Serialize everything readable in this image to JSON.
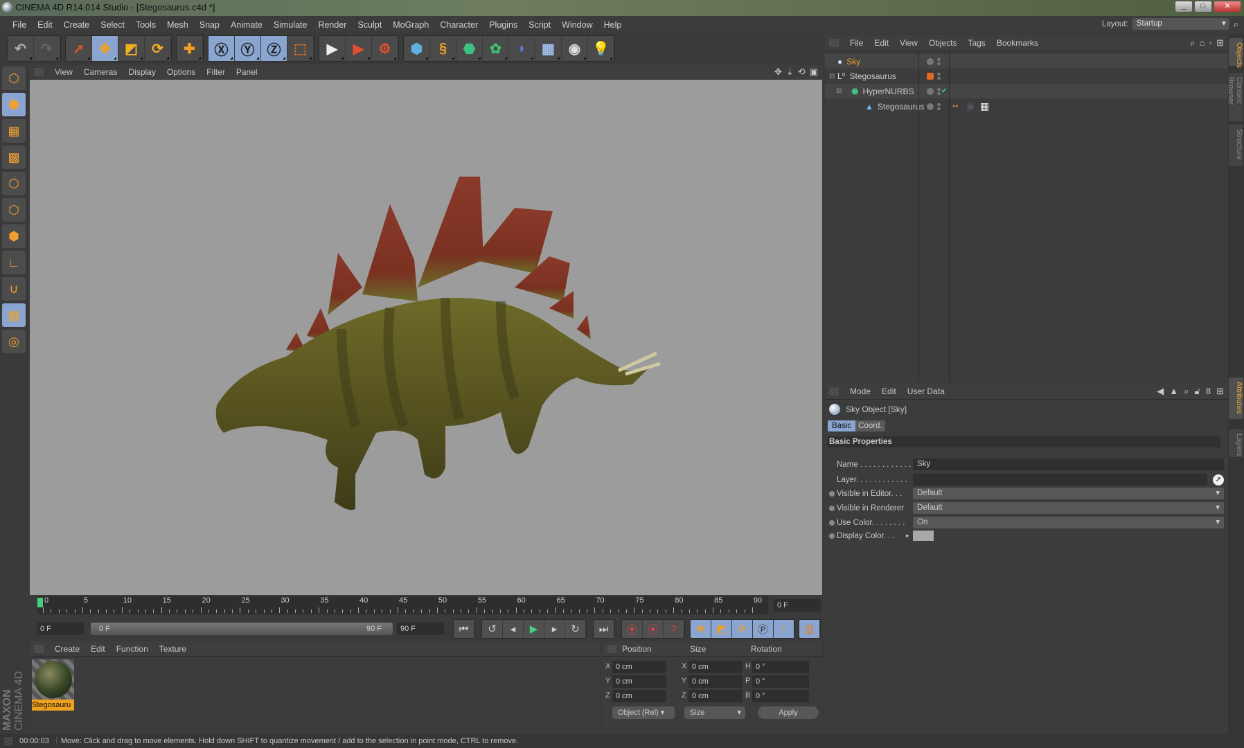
{
  "window": {
    "title": "CINEMA 4D R14.014 Studio - [Stegosaurus.c4d *]",
    "minimize": "_",
    "maximize": "□",
    "close": "✕"
  },
  "menu": [
    "File",
    "Edit",
    "Create",
    "Select",
    "Tools",
    "Mesh",
    "Snap",
    "Animate",
    "Simulate",
    "Render",
    "Sculpt",
    "MoGraph",
    "Character",
    "Plugins",
    "Script",
    "Window",
    "Help"
  ],
  "layout": {
    "label": "Layout:",
    "value": "Startup"
  },
  "toolbar": [
    {
      "group": [
        {
          "icon": "undo-icon",
          "glyph": "↶",
          "color": "#aaa"
        },
        {
          "icon": "redo-icon",
          "glyph": "↷",
          "color": "#666"
        }
      ]
    },
    {
      "group": [
        {
          "icon": "live-selection-icon",
          "glyph": "➚",
          "color": "#e05030"
        },
        {
          "icon": "move-icon",
          "glyph": "✥",
          "color": "#f0a020",
          "active": true
        },
        {
          "icon": "scale-icon",
          "glyph": "◩",
          "color": "#f0b020"
        },
        {
          "icon": "rotate-icon",
          "glyph": "⟳",
          "color": "#f0b020"
        }
      ]
    },
    {
      "group": [
        {
          "icon": "transform-icon",
          "glyph": "✚",
          "color": "#f0a020"
        }
      ]
    },
    {
      "group": [
        {
          "icon": "x-axis-icon",
          "glyph": "Ⓧ",
          "color": "#222",
          "active": true
        },
        {
          "icon": "y-axis-icon",
          "glyph": "Ⓨ",
          "color": "#222",
          "active": true
        },
        {
          "icon": "z-axis-icon",
          "glyph": "Ⓩ",
          "color": "#222",
          "active": true
        },
        {
          "icon": "coordinate-system-icon",
          "glyph": "⬚",
          "color": "#e07020"
        }
      ]
    },
    {
      "group": [
        {
          "icon": "render-view-icon",
          "glyph": "▶",
          "color": "#eee"
        },
        {
          "icon": "render-picture-viewer-icon",
          "glyph": "▶",
          "color": "#e05030"
        },
        {
          "icon": "render-settings-icon",
          "glyph": "⚙",
          "color": "#e05030"
        }
      ]
    },
    {
      "group": [
        {
          "icon": "cube-icon",
          "glyph": "⬢",
          "color": "#60b0e0"
        },
        {
          "icon": "spline-icon",
          "glyph": "§",
          "color": "#f0a020"
        },
        {
          "icon": "nurbs-icon",
          "glyph": "⬣",
          "color": "#40c080"
        },
        {
          "icon": "array-icon",
          "glyph": "✿",
          "color": "#40c070"
        },
        {
          "icon": "deformer-icon",
          "glyph": "◗",
          "color": "#6080e0"
        },
        {
          "icon": "floor-icon",
          "glyph": "▦",
          "color": "#a0c0f0"
        },
        {
          "icon": "camera-icon",
          "glyph": "◉",
          "color": "#ddd"
        },
        {
          "icon": "light-icon",
          "glyph": "💡",
          "color": "#eee"
        }
      ]
    }
  ],
  "left_tools": [
    {
      "icon": "model-icon",
      "glyph": "⬡"
    },
    {
      "icon": "object-mode-icon",
      "glyph": "⬢",
      "active": true
    },
    {
      "icon": "texture-icon",
      "glyph": "▦"
    },
    {
      "icon": "workplane-icon",
      "glyph": "▩"
    },
    {
      "icon": "points-icon",
      "glyph": "⬡"
    },
    {
      "icon": "edges-icon",
      "glyph": "⬡"
    },
    {
      "icon": "polygons-icon",
      "glyph": "⬢"
    },
    {
      "icon": "axis-icon",
      "glyph": "∟"
    },
    {
      "icon": "magnet-icon",
      "glyph": "∪"
    },
    {
      "icon": "grid-lock-icon",
      "glyph": "▦",
      "active": true
    },
    {
      "icon": "snap-icon",
      "glyph": "◎"
    }
  ],
  "viewport": {
    "menu": [
      "View",
      "Cameras",
      "Display",
      "Options",
      "Filter",
      "Panel"
    ]
  },
  "object_manager": {
    "menu": [
      "File",
      "Edit",
      "View",
      "Objects",
      "Tags",
      "Bookmarks"
    ],
    "objects": [
      {
        "name": "Sky",
        "selected": true,
        "indent": 0,
        "icon": "sky-icon"
      },
      {
        "name": "Stegosaurus",
        "indent": 0,
        "icon": "null-object-icon"
      },
      {
        "name": "HyperNURBS",
        "indent": 1,
        "icon": "hypernurbs-icon"
      },
      {
        "name": "Stegosaurus",
        "indent": 2,
        "icon": "polygon-object-icon"
      }
    ]
  },
  "side_tabs": [
    "Objects",
    "Content Browser",
    "Structure",
    "Attributes",
    "Layers"
  ],
  "attributes": {
    "menu": [
      "Mode",
      "Edit",
      "User Data"
    ],
    "object_title": "Sky Object [Sky]",
    "tabs": [
      "Basic",
      "Coord."
    ],
    "section": "Basic Properties",
    "fields": [
      {
        "label": "Name . . . . . . . . . . . .",
        "value": "Sky"
      },
      {
        "label": "Layer. . . . . . . . . . . .",
        "value": ""
      },
      {
        "label": "Visible in Editor. . .",
        "value": "Default"
      },
      {
        "label": "Visible in Renderer",
        "value": "Default"
      },
      {
        "label": "Use Color. . . . . . . .",
        "value": "On"
      },
      {
        "label": "Display Color. . .",
        "value": ""
      }
    ],
    "display_color": "#a8a8a8"
  },
  "timeline": {
    "ticks": [
      0,
      5,
      10,
      15,
      20,
      25,
      30,
      35,
      40,
      45,
      50,
      55,
      60,
      65,
      70,
      75,
      80,
      85,
      90
    ],
    "current_frame": "0 F",
    "start": "0 F",
    "range_start": "0 F",
    "range_end": "90 F",
    "end": "90 F",
    "progress": 0
  },
  "materials": {
    "menu": [
      "Create",
      "Edit",
      "Function",
      "Texture"
    ],
    "items": [
      {
        "name": "Stegosauru"
      }
    ]
  },
  "coordinates": {
    "headers": [
      "Position",
      "Size",
      "Rotation"
    ],
    "rows": [
      {
        "axis": "X",
        "pos": "0 cm",
        "saxis": "X",
        "size": "0 cm",
        "raxis": "H",
        "rot": "0 °"
      },
      {
        "axis": "Y",
        "pos": "0 cm",
        "saxis": "Y",
        "size": "0 cm",
        "raxis": "P",
        "rot": "0 °"
      },
      {
        "axis": "Z",
        "pos": "0 cm",
        "saxis": "Z",
        "size": "0 cm",
        "raxis": "B",
        "rot": "0 °"
      }
    ],
    "mode": "Object (Rel)",
    "size_mode": "Size",
    "apply": "Apply"
  },
  "brand": {
    "line1": "MAXON",
    "line2": "CINEMA 4D"
  },
  "status": {
    "time": "00:00:03",
    "message": "Move: Click and drag to move elements. Hold down SHIFT to quantize movement / add to the selection in point mode, CTRL to remove."
  }
}
